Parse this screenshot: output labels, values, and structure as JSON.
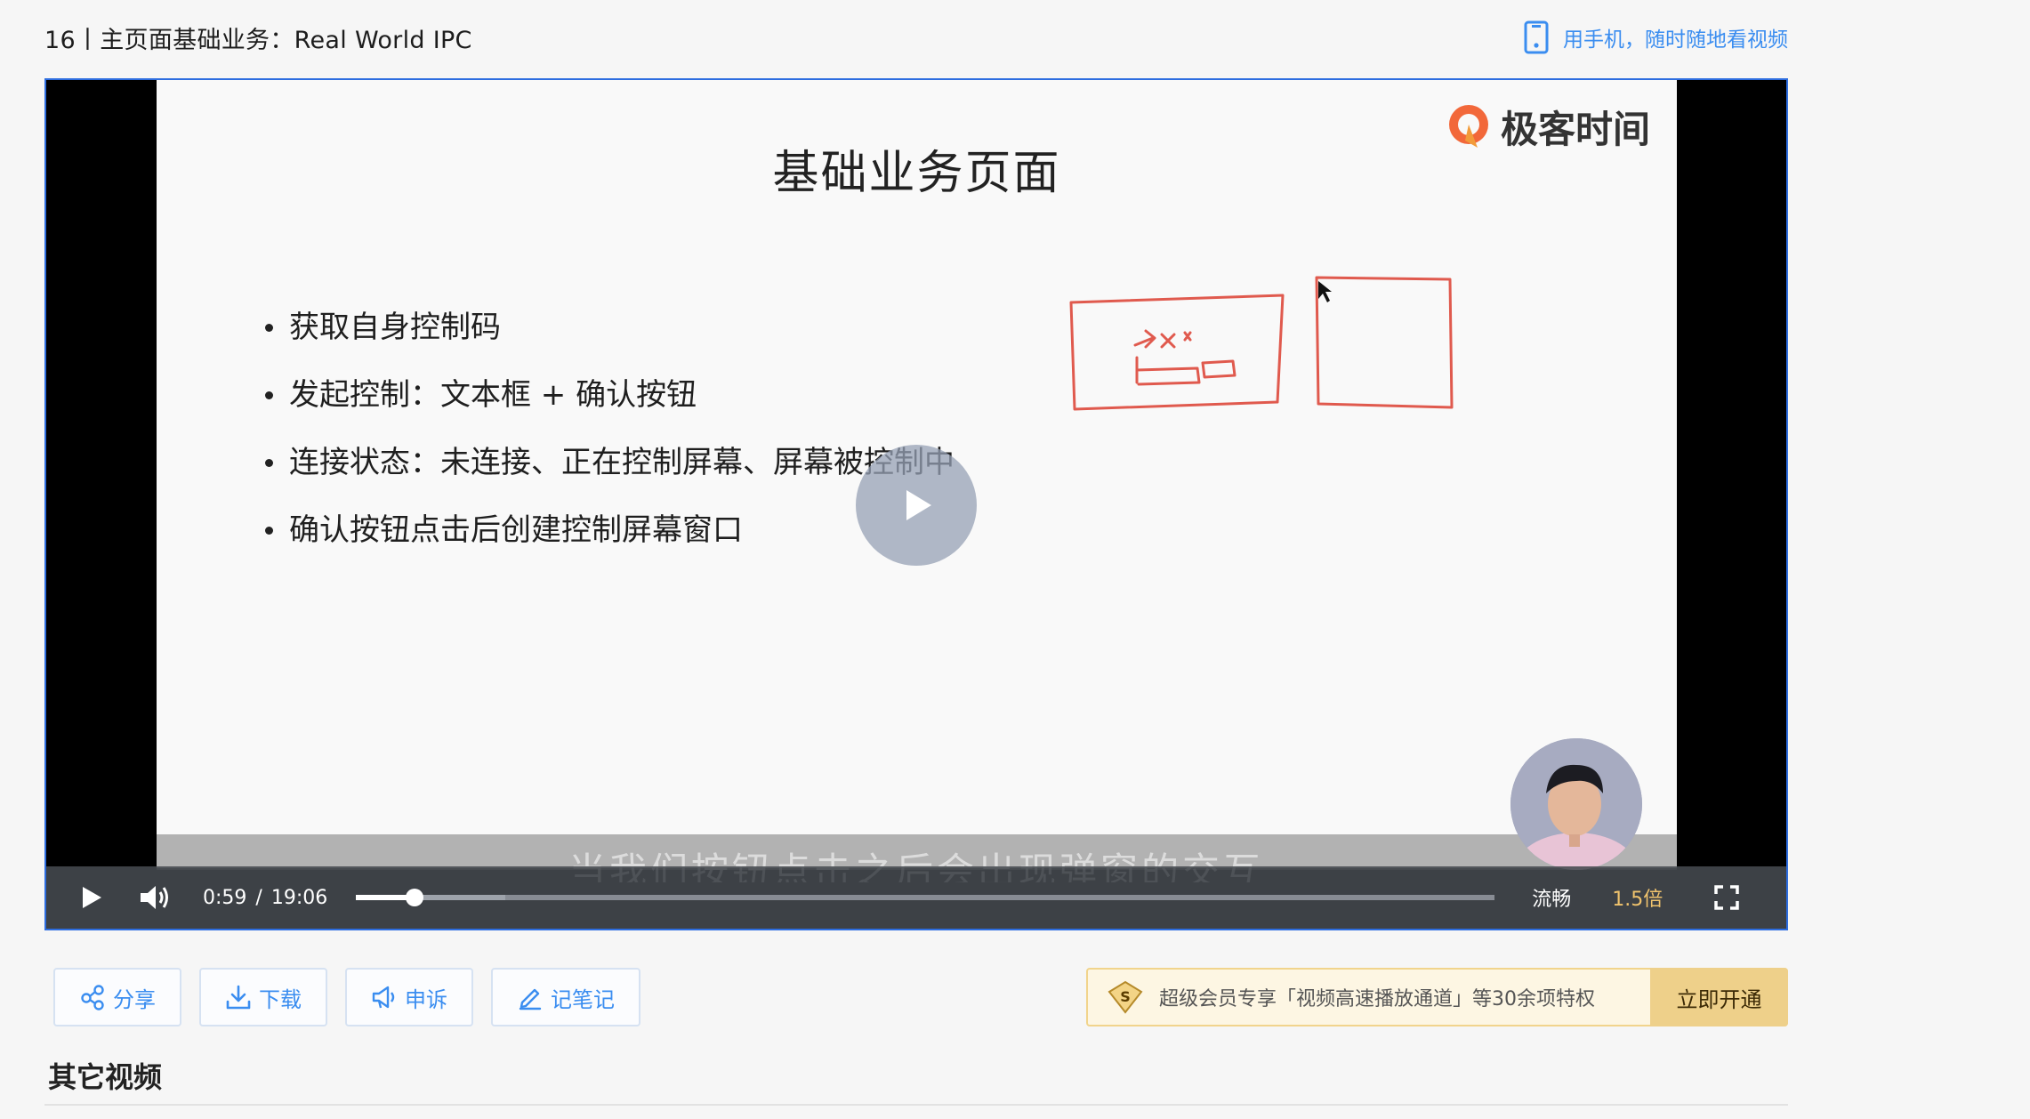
{
  "header": {
    "title": "16丨主页面基础业务：Real World IPC",
    "mobile_link": "用手机，随时随地看视频"
  },
  "slide": {
    "title": "基础业务页面",
    "brand": "极客时间",
    "bullets": [
      "获取自身控制码",
      "发起控制：文本框 + 确认按钮",
      "连接状态：未连接、正在控制屏幕、屏幕被控制中",
      "确认按钮点击后创建控制屏幕窗口"
    ],
    "subtitle": "当我们按钮点击之后会出现弹窗的交互"
  },
  "player": {
    "current_time": "0:59",
    "separator": "/",
    "duration": "19:06",
    "progress_fraction": 0.0515,
    "buffered_fraction": 0.131,
    "quality": "流畅",
    "speed": "1.5倍"
  },
  "actions": {
    "share": "分享",
    "download": "下载",
    "complain": "申诉",
    "notes": "记笔记"
  },
  "vip": {
    "text": "超级会员专享「视频高速播放通道」等30余项特权",
    "button": "立即开通"
  },
  "other_videos": {
    "title": "其它视频"
  },
  "colors": {
    "accent": "#3a8df0",
    "player_border": "#2d6de0",
    "speed": "#f0c36d",
    "vip_button": "#eed08a",
    "sketch": "#e05a4e"
  }
}
